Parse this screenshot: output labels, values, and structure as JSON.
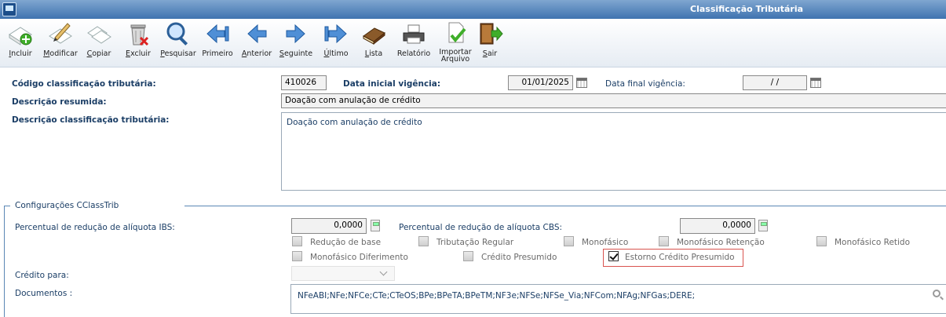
{
  "window": {
    "title": "Classificação Tributária"
  },
  "toolbar": {
    "incluir": "Incluir",
    "modificar": "Modificar",
    "copiar": "Copiar",
    "excluir": "Excluir",
    "pesquisar": "Pesquisar",
    "primeiro": "Primeiro",
    "anterior": "Anterior",
    "seguinte": "Seguinte",
    "ultimo": "Último",
    "lista": "Lista",
    "relatorio": "Relatório",
    "importar_1": "Importar",
    "importar_2": "Arquivo",
    "sair": "Sair"
  },
  "form": {
    "codigo_label": "Código classificação tributária:",
    "codigo_value": "410026",
    "data_inicial_label": "Data inicial vigência:",
    "data_inicial_value": "01/01/2025",
    "data_final_label": "Data final vigência:",
    "data_final_value": "/ /",
    "descricao_resumida_label": "Descrição resumida:",
    "descricao_resumida_value": "Doação com anulação de crédito",
    "descricao_label": "Descrição classificação tributária:",
    "descricao_value": "Doação com anulação de crédito"
  },
  "config": {
    "section_title": "Configurações CClassTrib",
    "ibs_label": "Percentual de redução de alíquota IBS:",
    "ibs_value": "0,0000",
    "cbs_label": "Percentual de redução de alíquota CBS:",
    "cbs_value": "0,0000",
    "checkboxes": {
      "reducao_base": "Redução de base",
      "tributacao_regular": "Tributação Regular",
      "monofasico": "Monofásico",
      "monofasico_retencao": "Monofásico Retenção",
      "monofasico_retido": "Monofásico Retido",
      "monofasico_diferimento": "Monofásico Diferimento",
      "credito_presumido": "Crédito Presumido",
      "estorno_credito_presumido": "Estorno Crédito Presumido"
    },
    "estorno_checked": true,
    "credito_para_label": "Crédito para:",
    "documentos_label": "Documentos :",
    "documentos_value": "NFeABI;NFe;NFCe;CTe;CTeOS;BPe;BPeTA;BPeTM;NF3e;NFSe;NFSe_Via;NFCom;NFAg;NFGas;DERE;"
  },
  "icons": [
    "add-document-icon",
    "edit-document-icon",
    "copy-document-icon",
    "trash-icon",
    "magnifier-icon",
    "first-arrow-icon",
    "prev-arrow-icon",
    "next-arrow-icon",
    "last-arrow-icon",
    "book-icon",
    "printer-icon",
    "import-file-icon",
    "exit-door-icon"
  ],
  "colors": {
    "titlebar": "#3f73b0",
    "label": "#1b3e66",
    "highlight": "#d9534f"
  }
}
